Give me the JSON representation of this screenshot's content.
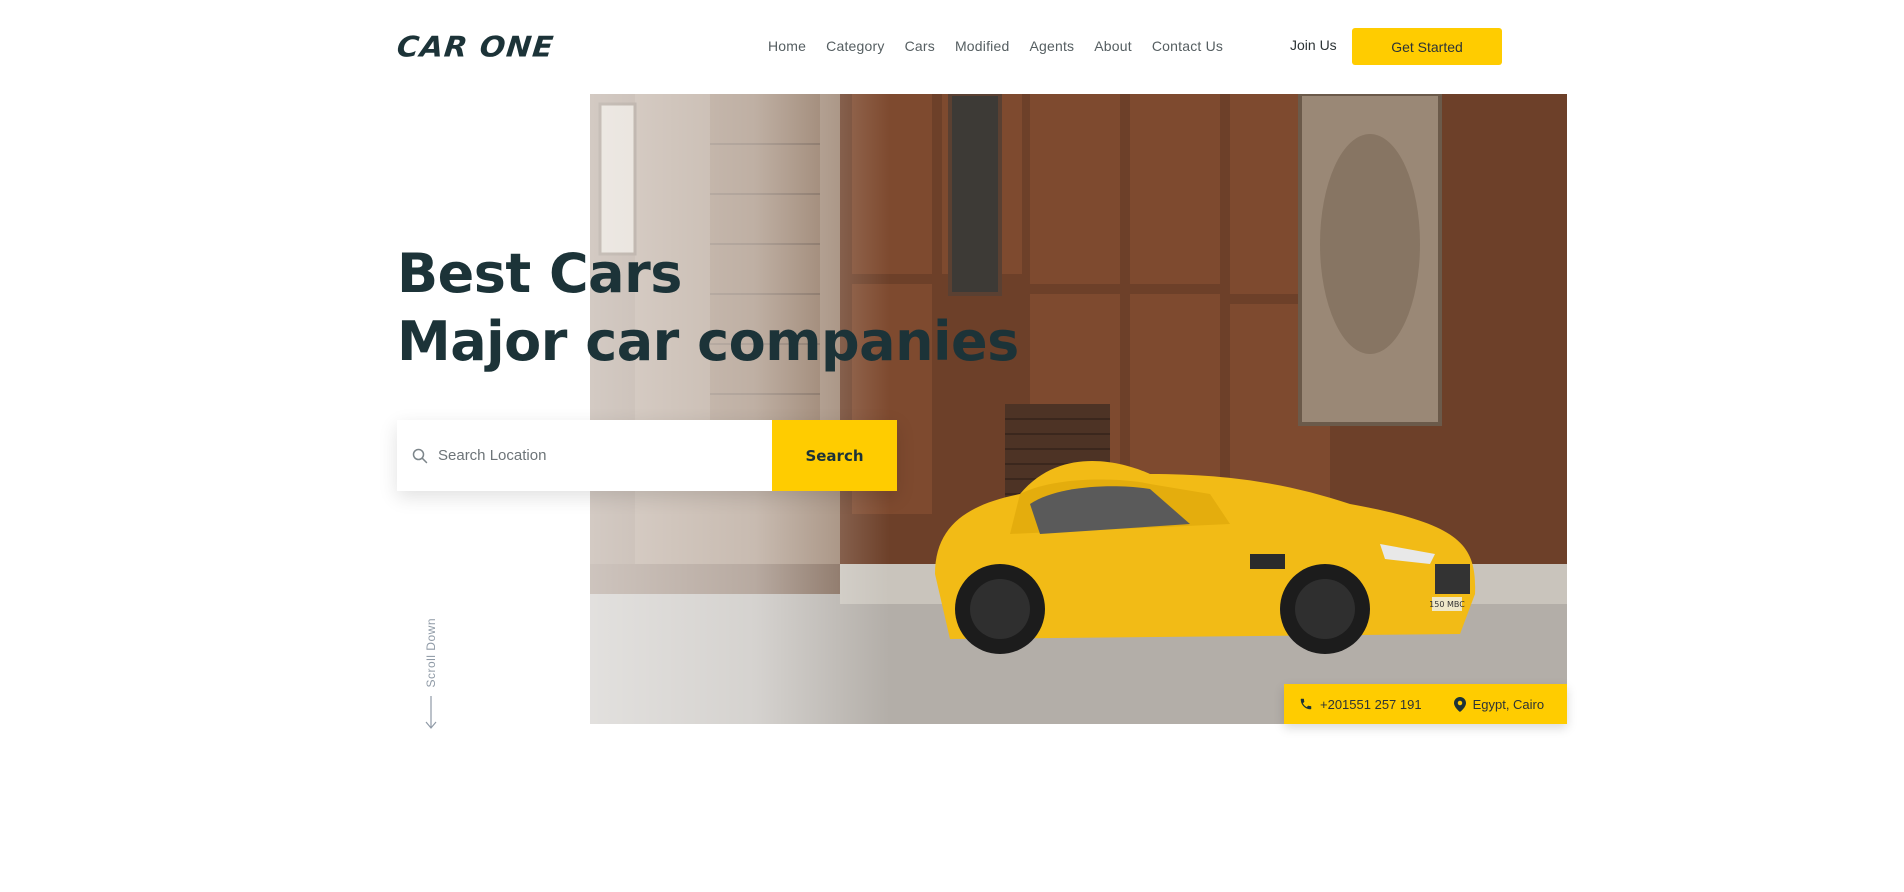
{
  "brand": {
    "logo_text": "CAR ONE"
  },
  "nav": {
    "items": [
      "Home",
      "Category",
      "Cars",
      "Modified",
      "Agents",
      "About",
      "Contact Us"
    ]
  },
  "header": {
    "join_label": "Join Us",
    "cta_label": "Get Started"
  },
  "hero": {
    "headline_line1": "Best Cars",
    "headline_line2": "Major car companies",
    "plate_text": "150 MBC"
  },
  "search": {
    "placeholder": "Search Location",
    "button_label": "Search"
  },
  "scroll": {
    "label": "Scroll Down"
  },
  "contact": {
    "phone": "+201551 257 191",
    "location": "Egypt, Cairo"
  },
  "colors": {
    "accent": "#ffcc00",
    "heading": "#1c3338",
    "nav_text": "#555e61"
  },
  "icons": {
    "search": "search-icon",
    "phone": "phone-icon",
    "location": "map-pin-icon",
    "scroll": "arrow-down-icon"
  }
}
